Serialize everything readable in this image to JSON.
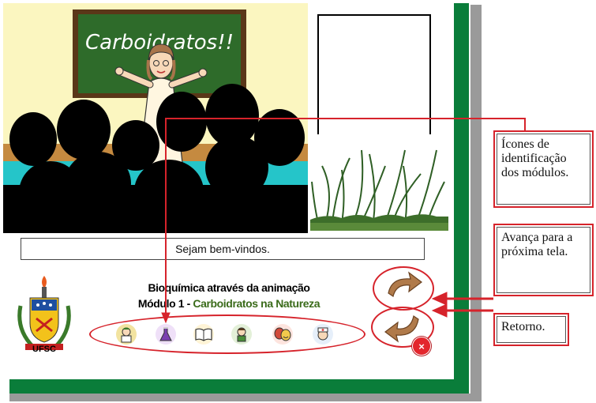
{
  "scene": {
    "board_text": "Carboidratos!!"
  },
  "message_bar": {
    "text": "Sejam bem-vindos."
  },
  "logo": {
    "text": "UFSC"
  },
  "titles": {
    "line1": "Bioquímica através da animação",
    "line2_module": "Módulo 1 -",
    "line2_subject": "Carboidratos na Natureza"
  },
  "modules": [
    {
      "icon": "scientist-icon",
      "color": "#f2c94c"
    },
    {
      "icon": "flask-icon",
      "color": "#7b3fb0"
    },
    {
      "icon": "book-icon",
      "color": "#e8b04a"
    },
    {
      "icon": "child-icon",
      "color": "#4a8f3a"
    },
    {
      "icon": "theater-masks-icon",
      "color": "#d14a3a"
    },
    {
      "icon": "nurse-icon",
      "color": "#e04040"
    }
  ],
  "buttons": {
    "next": "next-arrow-icon",
    "back": "back-arrow-icon",
    "close_glyph": "×"
  },
  "callouts": {
    "icons": "Ícones de identificação dos módulos.",
    "next": "Avança para a próxima tela.",
    "back": "Retorno."
  },
  "colors": {
    "accent_red": "#d6232b",
    "frame_green": "#0a7d3a",
    "board_green": "#2e6b2a"
  }
}
